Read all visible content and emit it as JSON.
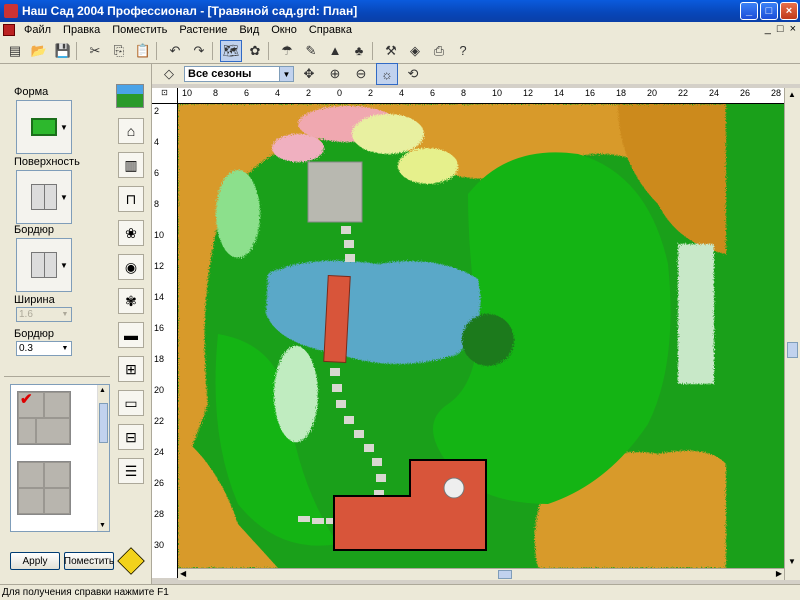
{
  "window": {
    "title": "Наш Сад 2004 Профессионал - [Травяной сад.grd: План]",
    "min": "_",
    "max": "□",
    "close": "×"
  },
  "menu": {
    "items": [
      "Файл",
      "Правка",
      "Поместить",
      "Растение",
      "Вид",
      "Окно",
      "Справка"
    ],
    "mdi_buttons": [
      "_",
      "□",
      "×"
    ]
  },
  "toolbar": {
    "season_value": "Все сезоны"
  },
  "left_panel": {
    "shape_label": "Форма",
    "surface_label": "Поверхность",
    "border_label": "Бордюр",
    "width_label": "Ширина",
    "width_value": "1.6",
    "border2_label": "Бордюр",
    "border2_value": "0.3",
    "apply_label": "Apply",
    "place_label": "Поместить"
  },
  "ruler": {
    "h_labels": [
      "10",
      "8",
      "6",
      "4",
      "2",
      "0",
      "2",
      "4",
      "6",
      "8",
      "10",
      "12",
      "14",
      "16",
      "18",
      "20",
      "22",
      "24",
      "26",
      "28"
    ],
    "v_labels": [
      "2",
      "4",
      "6",
      "8",
      "10",
      "12",
      "14",
      "16",
      "18",
      "20",
      "22",
      "24",
      "26",
      "28",
      "30"
    ]
  },
  "status": {
    "text": "Для получения справки нажмите F1"
  },
  "colors": {
    "lawn": "#1aa01a",
    "pond": "#5aa8c8",
    "deck": "#d8553a",
    "autumn": "#d89a2a"
  }
}
